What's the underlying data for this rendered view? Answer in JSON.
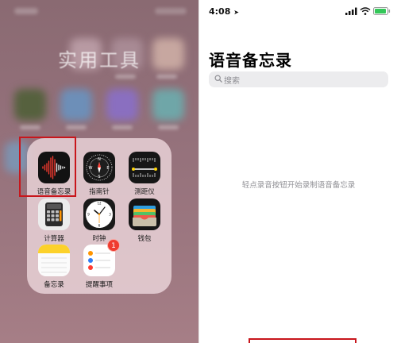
{
  "home": {
    "folder_title": "实用工具",
    "apps": [
      {
        "name": "voice-memos",
        "label": "语音备忘录"
      },
      {
        "name": "compass",
        "label": "指南针"
      },
      {
        "name": "measure",
        "label": "测距仪"
      },
      {
        "name": "calculator",
        "label": "计算器"
      },
      {
        "name": "clock",
        "label": "时钟"
      },
      {
        "name": "wallet",
        "label": "钱包"
      },
      {
        "name": "notes",
        "label": "备忘录"
      },
      {
        "name": "reminders",
        "label": "提醒事项",
        "badge": "1"
      }
    ]
  },
  "voice_memos": {
    "status_time": "4:08",
    "title": "语音备忘录",
    "search_placeholder": "搜索",
    "empty_hint": "轻点录音按钮开始录制语音备忘录"
  },
  "colors": {
    "highlight": "#c8161c",
    "badge": "#ef3b2f",
    "search_bg": "#ececee"
  }
}
